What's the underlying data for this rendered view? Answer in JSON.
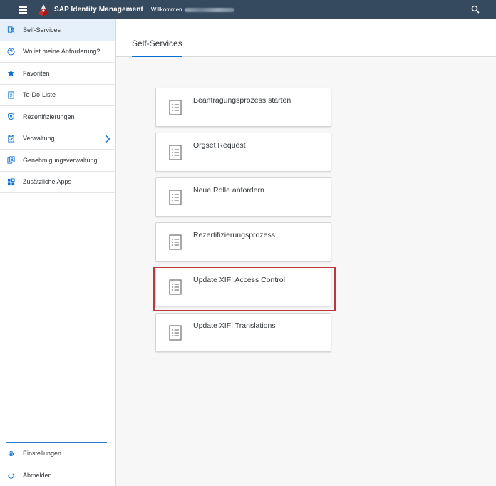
{
  "shellbar": {
    "app_title": "SAP Identity Management",
    "welcome": "Willkommen",
    "menu_icon": "hamburger-icon",
    "search_icon": "search-icon",
    "brand_color": "#354a5f"
  },
  "sidebar": {
    "items": [
      {
        "label": "Self-Services",
        "icon": "self-services-icon",
        "selected": true
      },
      {
        "label": "Wo ist meine Anforderung?",
        "icon": "question-circle-icon"
      },
      {
        "label": "Favoriten",
        "icon": "star-icon"
      },
      {
        "label": "To-Do-Liste",
        "icon": "task-list-icon"
      },
      {
        "label": "Rezertifizierungen",
        "icon": "shield-icon"
      },
      {
        "label": "Verwaltung",
        "icon": "clipboard-icon",
        "has_submenu": true
      },
      {
        "label": "Genehmigungsverwaltung",
        "icon": "approvals-icon"
      },
      {
        "label": "Zusätzliche Apps",
        "icon": "apps-icon"
      }
    ],
    "bottom_items": [
      {
        "label": "Einstellungen",
        "icon": "settings-icon"
      },
      {
        "label": "Abmelden",
        "icon": "logout-icon"
      }
    ],
    "selected_color": "#e5f0fa",
    "accent_color": "#0a6ed1"
  },
  "main": {
    "page_title": "Self-Services",
    "tiles": [
      {
        "label": "Beantragungsprozess starten",
        "icon": "list-document-icon"
      },
      {
        "label": "Orgset Request",
        "icon": "list-document-icon"
      },
      {
        "label": "Neue Rolle anfordern",
        "icon": "list-document-icon"
      },
      {
        "label": "Rezertifizierungsprozess",
        "icon": "list-document-icon"
      },
      {
        "label": "Update XIFI Access Control",
        "icon": "list-document-icon",
        "highlighted": true
      },
      {
        "label": "Update XIFI Translations",
        "icon": "list-document-icon"
      }
    ],
    "highlight_color": "#b8393e"
  }
}
